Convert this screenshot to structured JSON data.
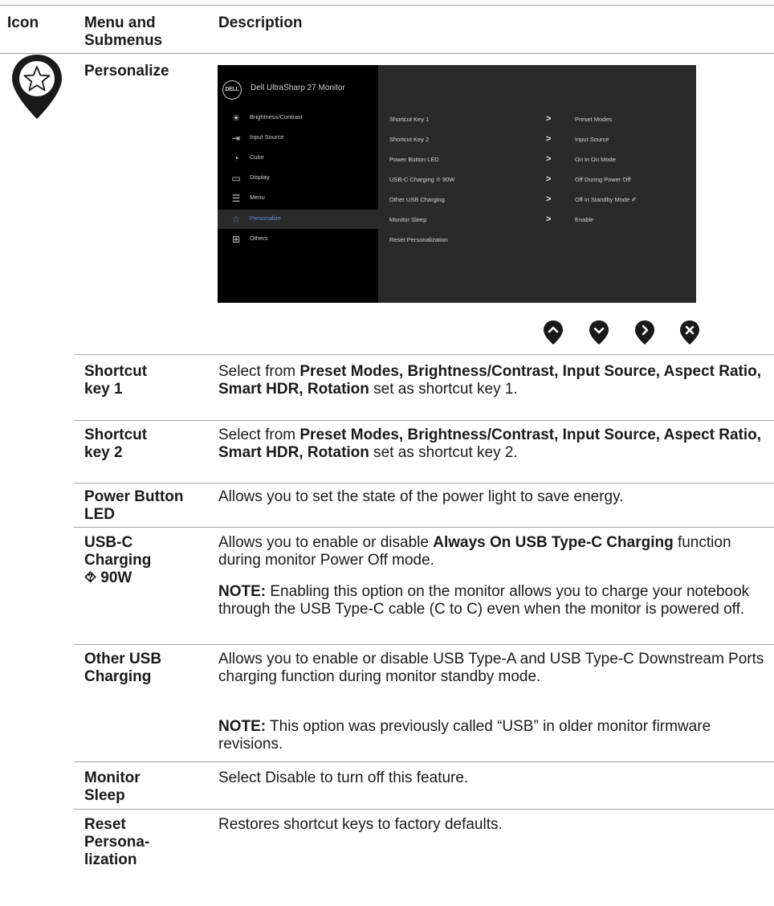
{
  "header": {
    "icon": "Icon",
    "menu": "Menu and Submenus",
    "description": "Description"
  },
  "menu_title": "Personalize",
  "osd": {
    "logo": "DELL",
    "title": "Dell UltraSharp 27 Monitor",
    "menu_items": [
      {
        "label": "Brightness/Contrast",
        "icon": "sun-icon",
        "selected": false
      },
      {
        "label": "Input Source",
        "icon": "input-icon",
        "selected": false
      },
      {
        "label": "Color",
        "icon": "palette-icon",
        "selected": false
      },
      {
        "label": "Display",
        "icon": "display-icon",
        "selected": false
      },
      {
        "label": "Menu",
        "icon": "menu-icon",
        "selected": false
      },
      {
        "label": "Personalize",
        "icon": "star-icon",
        "selected": true
      },
      {
        "label": "Others",
        "icon": "others-icon",
        "selected": false
      }
    ],
    "options": [
      {
        "label": "Shortcut Key 1",
        "value": "Preset Modes"
      },
      {
        "label": "Shortcut Key 2",
        "value": "Input Source"
      },
      {
        "label": "Power Button LED",
        "value": "On in On Mode"
      },
      {
        "label": "USB-C Charging ⯑ 90W",
        "value": "Off During Power Off"
      },
      {
        "label": "Other USB Charging",
        "value": "Off in Standby Mode ✐"
      },
      {
        "label": "Monitor Sleep",
        "value": "Enable"
      },
      {
        "label": "Reset Personalization",
        "value": ""
      }
    ],
    "accent": "#5a8ed0"
  },
  "nav_buttons": [
    "up-icon",
    "down-icon",
    "right-icon",
    "close-icon"
  ],
  "rows": [
    {
      "name": "Shortcut\nkey 1",
      "p1a": "Select from ",
      "p1b": "Preset Modes, Brightness/Contrast, Input Source, Aspect Ratio, Smart HDR, Rotation",
      "p1c": " set as shortcut key 1."
    },
    {
      "name": "Shortcut\nkey 2",
      "p1a": "Select from ",
      "p1b": "Preset Modes, Brightness/Contrast, Input Source, Aspect Ratio, Smart HDR, Rotation",
      "p1c": " set as shortcut key 2."
    },
    {
      "name": "Power Button\nLED",
      "p1a": "Allows you to set the state of the power light to save energy."
    },
    {
      "name": "USB-C\nCharging\n⯑ 90W",
      "p1a": "Allows you to enable or disable ",
      "p1b": "Always On USB Type-C Charging",
      "p1c": " function during monitor Power Off mode.",
      "note_label": "NOTE:",
      "note": " Enabling this option on the monitor allows you to charge your notebook through the USB Type-C cable (C to C) even when the monitor is powered off."
    },
    {
      "name": "Other USB\nCharging",
      "p1a": "Allows you to enable or disable USB Type-A and USB Type-C Downstream Ports charging function during monitor standby mode.",
      "note_label": "NOTE:",
      "note": " This option was previously called “USB” in older monitor firmware revisions."
    },
    {
      "name": "Monitor\nSleep",
      "p1a": "Select Disable to turn off this feature."
    },
    {
      "name": "Reset\nPersona-\nlization",
      "p1a": "Restores shortcut keys to factory defaults."
    }
  ]
}
